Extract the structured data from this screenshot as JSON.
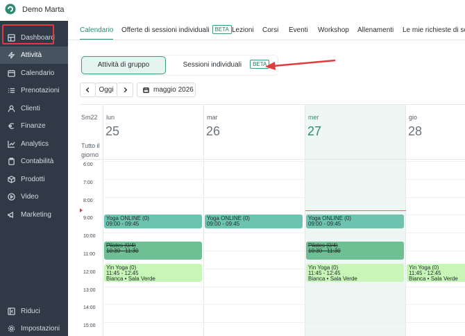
{
  "app": {
    "name": "Demo Marta"
  },
  "sidebar": {
    "items": [
      {
        "label": "Dashboard",
        "icon": "dashboard-icon"
      },
      {
        "label": "Attività",
        "icon": "bolt-icon",
        "active": true
      },
      {
        "label": "Calendario",
        "icon": "calendar-icon"
      },
      {
        "label": "Prenotazioni",
        "icon": "list-icon"
      },
      {
        "label": "Clienti",
        "icon": "user-icon"
      },
      {
        "label": "Finanze",
        "icon": "euro-icon"
      },
      {
        "label": "Analytics",
        "icon": "chart-icon"
      },
      {
        "label": "Contabilità",
        "icon": "clipboard-icon"
      },
      {
        "label": "Prodotti",
        "icon": "box-icon"
      },
      {
        "label": "Video",
        "icon": "play-icon"
      },
      {
        "label": "Marketing",
        "icon": "megaphone-icon"
      }
    ],
    "bottom": [
      {
        "label": "Riduci",
        "icon": "collapse-icon"
      },
      {
        "label": "Impostazioni",
        "icon": "gear-icon"
      }
    ]
  },
  "tabs": [
    {
      "label": "Calendario",
      "active": true
    },
    {
      "label": "Offerte di sessioni individuali",
      "badge": "BETA"
    },
    {
      "label": "Lezioni"
    },
    {
      "label": "Corsi"
    },
    {
      "label": "Eventi"
    },
    {
      "label": "Workshop"
    },
    {
      "label": "Allenamenti"
    },
    {
      "label": "Le mie richieste di sostituzione"
    }
  ],
  "segment": {
    "group_label": "Attività di gruppo",
    "individual_label": "Sessioni individuali",
    "individual_badge": "BETA"
  },
  "date_nav": {
    "today_label": "Oggi",
    "month_label": "maggio 2026"
  },
  "calendar": {
    "week_label": "Sm22",
    "allday_label": "Tutto il giorno",
    "days": [
      {
        "name": "lun",
        "number": "25"
      },
      {
        "name": "mar",
        "number": "26"
      },
      {
        "name": "mer",
        "number": "27",
        "today": true
      },
      {
        "name": "gio",
        "number": "28"
      }
    ],
    "hours": [
      "6:00",
      "7:00",
      "8:00",
      "9:00",
      "10:00",
      "11:00",
      "12:00",
      "13:00",
      "14:00",
      "15:00"
    ],
    "events": [
      {
        "day": 0,
        "title": "Yoga ONLINE (0)",
        "time": "09:00 - 09:45",
        "kind": "yoga-online"
      },
      {
        "day": 1,
        "title": "Yoga ONLINE (0)",
        "time": "09:00 - 09:45",
        "kind": "yoga-online"
      },
      {
        "day": 2,
        "title": "Yoga ONLINE (0)",
        "time": "09:00 - 09:45",
        "kind": "yoga-online"
      },
      {
        "day": 0,
        "title": "Pilates (0/4)",
        "time": "10:30 - 11:30",
        "kind": "pilates"
      },
      {
        "day": 2,
        "title": "Pilates (0/4)",
        "time": "10:30 - 11:30",
        "kind": "pilates"
      },
      {
        "day": 0,
        "title": "Yin Yoga (0)",
        "time": "11:45 - 12:45",
        "location": "Bianca • Sala Verde",
        "kind": "yin"
      },
      {
        "day": 2,
        "title": "Yin Yoga (0)",
        "time": "11:45 - 12:45",
        "location": "Bianca • Sala Verde",
        "kind": "yin"
      },
      {
        "day": 3,
        "title": "Yin Yoga (0)",
        "time": "11:45 - 12:45",
        "location": "Bianca • Sala Verde",
        "kind": "yin"
      }
    ]
  },
  "colors": {
    "accent": "#2e8b73",
    "sidebar_bg": "#2f3a46",
    "annotation": "#e23b3b",
    "yoga_online": "#6cc3b0",
    "pilates": "#6fbf95",
    "yin_yoga": "#c8f5b8"
  }
}
